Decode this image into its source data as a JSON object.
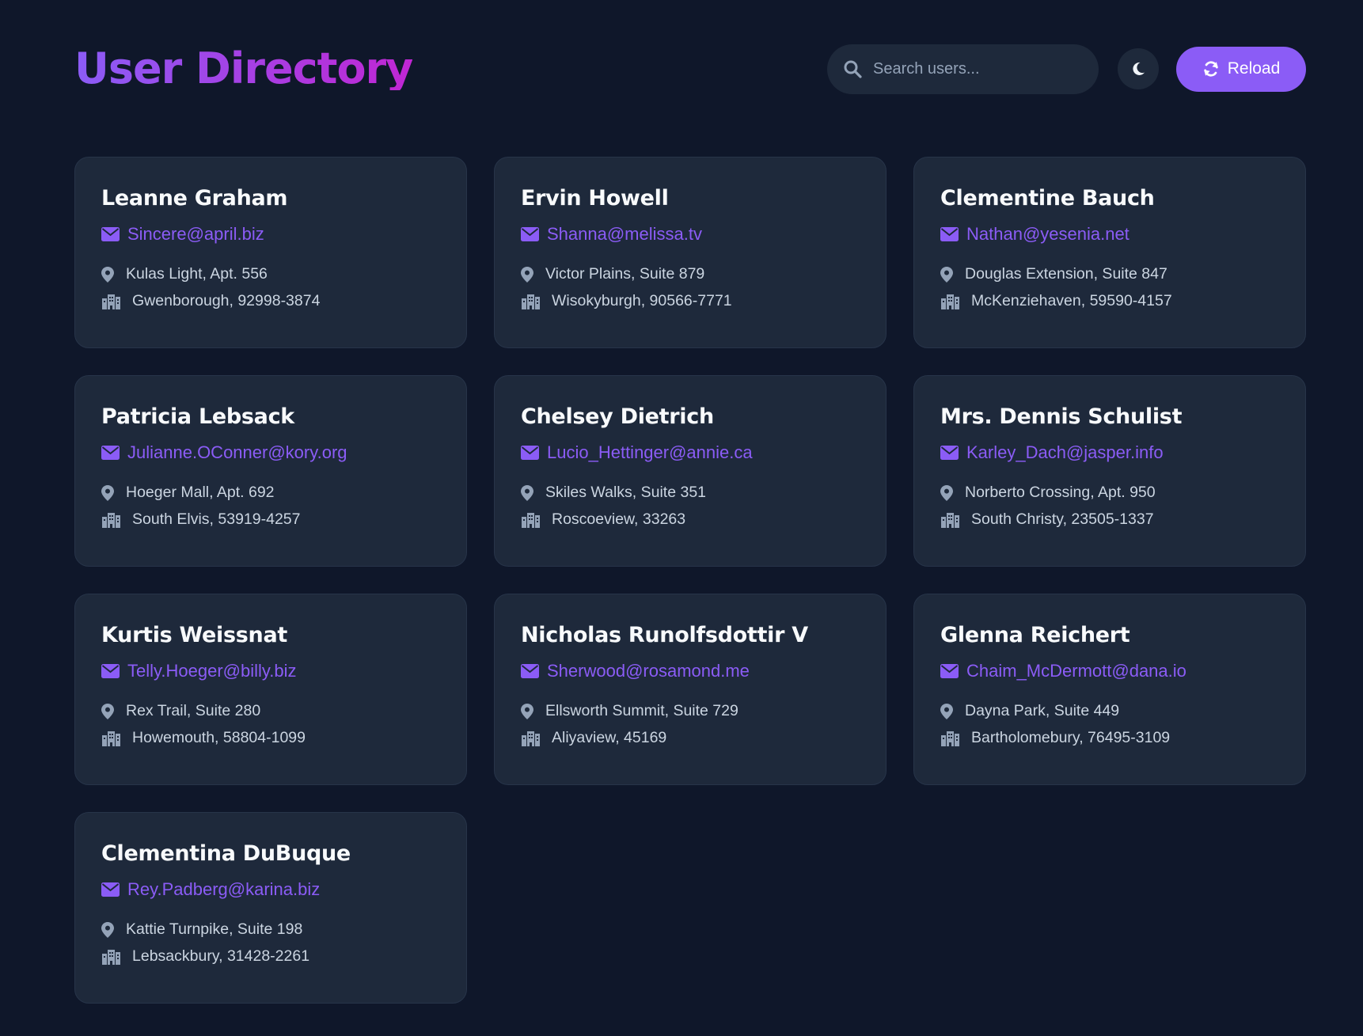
{
  "header": {
    "title": "User Directory",
    "search_placeholder": "Search users...",
    "reload_label": "Reload",
    "theme_icon": "moon-icon"
  },
  "colors": {
    "background": "#0f172a",
    "card": "#1e293b",
    "accent": "#8b5cf6",
    "title_gradient_end": "#c026d3"
  },
  "users": [
    {
      "name": "Leanne Graham",
      "email": "Sincere@april.biz",
      "street": "Kulas Light, Apt. 556",
      "city": "Gwenborough, 92998-3874"
    },
    {
      "name": "Ervin Howell",
      "email": "Shanna@melissa.tv",
      "street": "Victor Plains, Suite 879",
      "city": "Wisokyburgh, 90566-7771"
    },
    {
      "name": "Clementine Bauch",
      "email": "Nathan@yesenia.net",
      "street": "Douglas Extension, Suite 847",
      "city": "McKenziehaven, 59590-4157"
    },
    {
      "name": "Patricia Lebsack",
      "email": "Julianne.OConner@kory.org",
      "street": "Hoeger Mall, Apt. 692",
      "city": "South Elvis, 53919-4257"
    },
    {
      "name": "Chelsey Dietrich",
      "email": "Lucio_Hettinger@annie.ca",
      "street": "Skiles Walks, Suite 351",
      "city": "Roscoeview, 33263"
    },
    {
      "name": "Mrs. Dennis Schulist",
      "email": "Karley_Dach@jasper.info",
      "street": "Norberto Crossing, Apt. 950",
      "city": "South Christy, 23505-1337"
    },
    {
      "name": "Kurtis Weissnat",
      "email": "Telly.Hoeger@billy.biz",
      "street": "Rex Trail, Suite 280",
      "city": "Howemouth, 58804-1099"
    },
    {
      "name": "Nicholas Runolfsdottir V",
      "email": "Sherwood@rosamond.me",
      "street": "Ellsworth Summit, Suite 729",
      "city": "Aliyaview, 45169"
    },
    {
      "name": "Glenna Reichert",
      "email": "Chaim_McDermott@dana.io",
      "street": "Dayna Park, Suite 449",
      "city": "Bartholomebury, 76495-3109"
    },
    {
      "name": "Clementina DuBuque",
      "email": "Rey.Padberg@karina.biz",
      "street": "Kattie Turnpike, Suite 198",
      "city": "Lebsackbury, 31428-2261"
    }
  ]
}
